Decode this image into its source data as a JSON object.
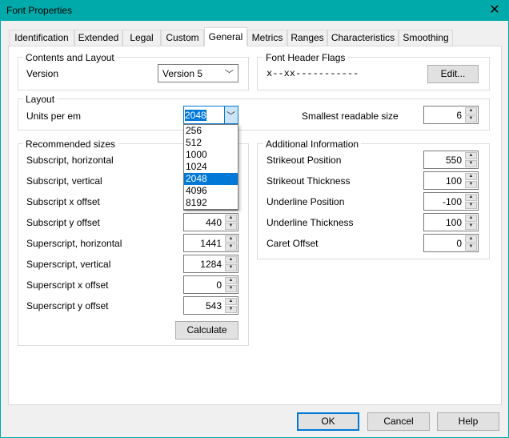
{
  "window": {
    "title": "Font Properties",
    "close_icon": "close-icon"
  },
  "tabs": [
    {
      "label": "Identification"
    },
    {
      "label": "Extended"
    },
    {
      "label": "Legal"
    },
    {
      "label": "Custom"
    },
    {
      "label": "General",
      "active": true
    },
    {
      "label": "Metrics"
    },
    {
      "label": "Ranges"
    },
    {
      "label": "Characteristics"
    },
    {
      "label": "Smoothing"
    }
  ],
  "contents": {
    "title": "Contents and Layout",
    "version_label": "Version",
    "version_value": "Version 5"
  },
  "flags": {
    "title": "Font Header Flags",
    "value": "x--xx-----------",
    "edit_label": "Edit..."
  },
  "layout": {
    "title": "Layout",
    "units_label": "Units per em",
    "units_value": "2048",
    "units_options": [
      "256",
      "512",
      "1000",
      "1024",
      "2048",
      "4096",
      "8192"
    ],
    "selected_option": "2048",
    "smallest_label": "Smallest readable size",
    "smallest_value": "6"
  },
  "recommended": {
    "title": "Recommended sizes",
    "rows": [
      {
        "label": "Subscript, horizontal",
        "value": ""
      },
      {
        "label": "Subscript, vertical",
        "value": ""
      },
      {
        "label": "Subscript x offset",
        "value": ""
      },
      {
        "label": "Subscript y offset",
        "value": "440"
      },
      {
        "label": "Superscript, horizontal",
        "value": "1441"
      },
      {
        "label": "Superscript, vertical",
        "value": "1284"
      },
      {
        "label": "Superscript x offset",
        "value": "0"
      },
      {
        "label": "Superscript y offset",
        "value": "543"
      }
    ],
    "calculate_label": "Calculate"
  },
  "additional": {
    "title": "Additional Information",
    "rows": [
      {
        "label": "Strikeout Position",
        "value": "550"
      },
      {
        "label": "Strikeout Thickness",
        "value": "100"
      },
      {
        "label": "Underline Position",
        "value": "-100"
      },
      {
        "label": "Underline Thickness",
        "value": "100"
      },
      {
        "label": "Caret Offset",
        "value": "0"
      }
    ]
  },
  "buttons": {
    "ok": "OK",
    "cancel": "Cancel",
    "help": "Help"
  },
  "colors": {
    "titlebar": "#00aaaa",
    "selection": "#0078d7"
  }
}
